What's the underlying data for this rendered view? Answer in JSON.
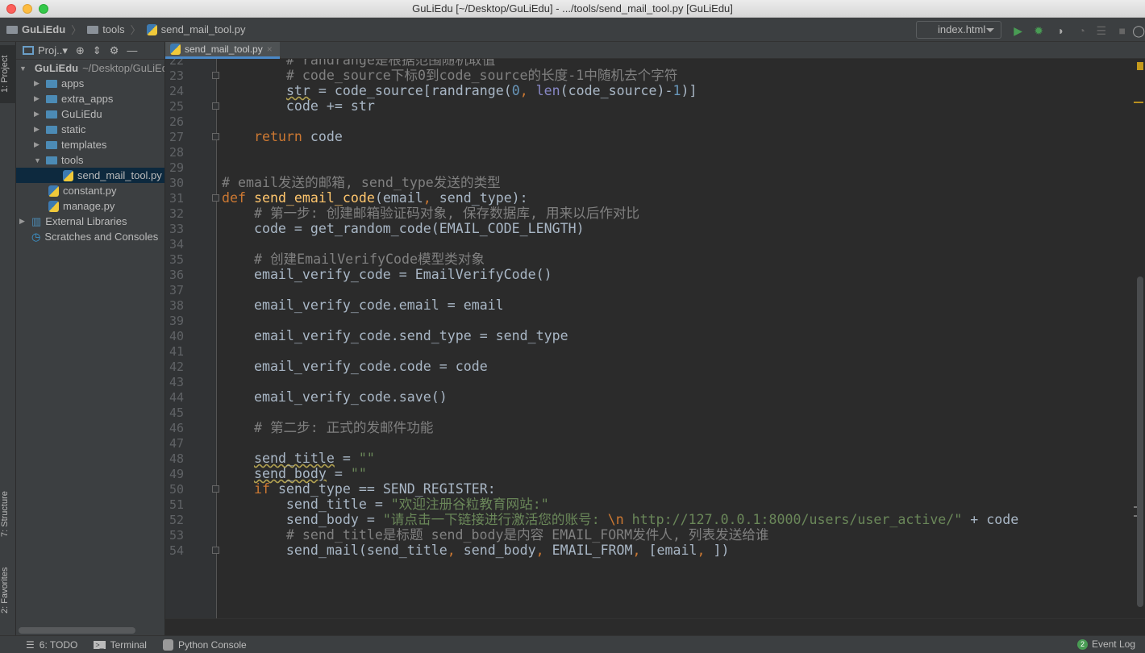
{
  "window": {
    "title": "GuLiEdu [~/Desktop/GuLiEdu] - .../tools/send_mail_tool.py [GuLiEdu]"
  },
  "breadcrumb": [
    "GuLiEdu",
    "tools",
    "send_mail_tool.py"
  ],
  "toolbar": {
    "run_config": "index.html"
  },
  "left_stripe": {
    "project": "1: Project",
    "structure": "7: Structure",
    "favorites": "2: Favorites"
  },
  "project_panel": {
    "title": "Proj..▾",
    "tree": [
      {
        "label": "GuLiEdu",
        "hint": "~/Desktop/GuLiEdu",
        "type": "root",
        "depth": 0,
        "expanded": true
      },
      {
        "label": "apps",
        "type": "folder",
        "depth": 1
      },
      {
        "label": "extra_apps",
        "type": "folder",
        "depth": 1
      },
      {
        "label": "GuLiEdu",
        "type": "folder",
        "depth": 1
      },
      {
        "label": "static",
        "type": "folder",
        "depth": 1
      },
      {
        "label": "templates",
        "type": "folder",
        "depth": 1
      },
      {
        "label": "tools",
        "type": "folder",
        "depth": 1,
        "expanded": true
      },
      {
        "label": "send_mail_tool.py",
        "type": "py",
        "depth": 2,
        "selected": true
      },
      {
        "label": "constant.py",
        "type": "py",
        "depth": 1
      },
      {
        "label": "manage.py",
        "type": "py",
        "depth": 1
      },
      {
        "label": "External Libraries",
        "type": "lib",
        "depth": 0
      },
      {
        "label": "Scratches and Consoles",
        "type": "scratch",
        "depth": 0
      }
    ]
  },
  "editor": {
    "tab": "send_mail_tool.py",
    "first_line": 22,
    "lines": [
      [
        [
          "cm",
          "        # randrange是根据范围随机取值"
        ]
      ],
      [
        [
          "cm",
          "        # code_source下标0到code_source的长度-1中随机去个字符"
        ]
      ],
      [
        [
          "",
          "        "
        ],
        [
          "warn",
          "str"
        ],
        [
          "",
          " = code_source[randrange("
        ],
        [
          "num",
          "0"
        ],
        [
          "kw",
          ", "
        ],
        [
          "bi",
          "len"
        ],
        [
          "",
          "(code_source)-"
        ],
        [
          "num",
          "1"
        ],
        [
          "",
          ")]"
        ]
      ],
      [
        [
          "",
          "        code += str"
        ]
      ],
      [],
      [
        [
          "",
          "    "
        ],
        [
          "kw",
          "return"
        ],
        [
          "",
          " code"
        ]
      ],
      [],
      [],
      [
        [
          "cm",
          "# email发送的邮箱, send_type发送的类型"
        ]
      ],
      [
        [
          "kw",
          "def "
        ],
        [
          "fn",
          "send_email_code"
        ],
        [
          "",
          "(email"
        ],
        [
          "kw",
          ", "
        ],
        [
          "",
          "send_type):"
        ]
      ],
      [
        [
          "cm",
          "    # 第一步: 创建邮箱验证码对象, 保存数据库, 用来以后作对比"
        ]
      ],
      [
        [
          "",
          "    code = get_random_code(EMAIL_CODE_LENGTH)"
        ]
      ],
      [],
      [
        [
          "cm",
          "    # 创建EmailVerifyCode模型类对象"
        ]
      ],
      [
        [
          "",
          "    email_verify_code = EmailVerifyCode()"
        ]
      ],
      [],
      [
        [
          "",
          "    email_verify_code.email = email"
        ]
      ],
      [],
      [
        [
          "",
          "    email_verify_code.send_type = send_type"
        ]
      ],
      [],
      [
        [
          "",
          "    email_verify_code.code = code"
        ]
      ],
      [],
      [
        [
          "",
          "    email_verify_code.save()"
        ]
      ],
      [],
      [
        [
          "cm",
          "    # 第二步: 正式的发邮件功能"
        ]
      ],
      [],
      [
        [
          "",
          "    "
        ],
        [
          "warn",
          "send_title"
        ],
        [
          "",
          " = "
        ],
        [
          "str",
          "\"\""
        ]
      ],
      [
        [
          "",
          "    "
        ],
        [
          "warn",
          "send_body"
        ],
        [
          "",
          " = "
        ],
        [
          "str",
          "\"\""
        ]
      ],
      [
        [
          "",
          "    "
        ],
        [
          "kw",
          "if"
        ],
        [
          "",
          " send_type == SEND_REGISTER:"
        ]
      ],
      [
        [
          "",
          "        send_title = "
        ],
        [
          "str",
          "\"欢迎注册谷粒教育网站:\""
        ]
      ],
      [
        [
          "",
          "        send_body = "
        ],
        [
          "str",
          "\"请点击一下链接进行激活您的账号: "
        ],
        [
          "esc",
          "\\n"
        ],
        [
          "str",
          " http://127.0.0.1:8000/users/user_active/\""
        ],
        [
          "",
          " + code"
        ]
      ],
      [
        [
          "cm",
          "        # send_title是标题 send_body是内容 EMAIL_FORM发件人, 列表发送给谁"
        ]
      ],
      [
        [
          "",
          "        send_mail(send_title"
        ],
        [
          "kw",
          ", "
        ],
        [
          "",
          "send_body"
        ],
        [
          "kw",
          ", "
        ],
        [
          "",
          "EMAIL_FROM"
        ],
        [
          "kw",
          ", "
        ],
        [
          "",
          "[email"
        ],
        [
          "kw",
          ", "
        ],
        [
          "",
          "])"
        ]
      ]
    ],
    "fold_lines": [
      23,
      25,
      27,
      31,
      50,
      54
    ]
  },
  "statusbar": {
    "todo": "6: TODO",
    "terminal": "Terminal",
    "python_console": "Python Console",
    "event_log": "Event Log",
    "event_count": "2"
  }
}
